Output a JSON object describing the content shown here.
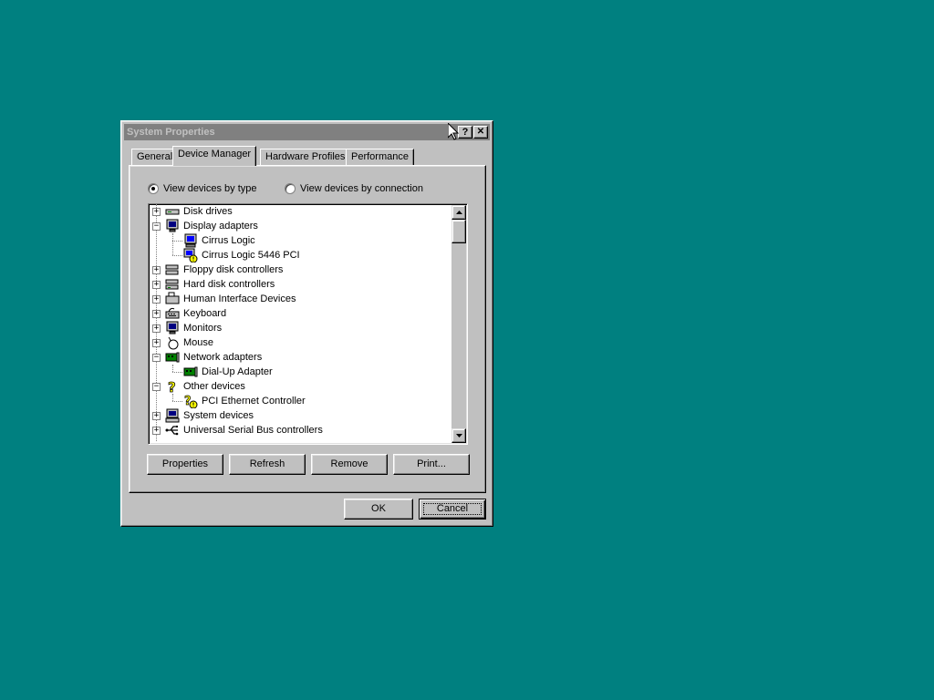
{
  "window": {
    "title": "System Properties",
    "help_glyph": "?",
    "close_glyph": "✕"
  },
  "tabs": [
    {
      "label": "General",
      "active": false
    },
    {
      "label": "Device Manager",
      "active": true
    },
    {
      "label": "Hardware Profiles",
      "active": false
    },
    {
      "label": "Performance",
      "active": false
    }
  ],
  "view_options": {
    "by_type": {
      "label": "View devices by type",
      "selected": true
    },
    "by_connection": {
      "label": "View devices by connection",
      "selected": false
    }
  },
  "tree": [
    {
      "label": "Disk drives",
      "level": 0,
      "expander": "+",
      "icon": "disk-drive-icon"
    },
    {
      "label": "Display adapters",
      "level": 0,
      "expander": "−",
      "icon": "monitor-icon"
    },
    {
      "label": "Cirrus Logic",
      "level": 1,
      "icon": "display-adapter-icon"
    },
    {
      "label": "Cirrus Logic 5446 PCI",
      "level": 1,
      "icon": "display-adapter-warning-icon"
    },
    {
      "label": "Floppy disk controllers",
      "level": 0,
      "expander": "+",
      "icon": "floppy-controller-icon"
    },
    {
      "label": "Hard disk controllers",
      "level": 0,
      "expander": "+",
      "icon": "hard-disk-controller-icon"
    },
    {
      "label": "Human Interface Devices",
      "level": 0,
      "expander": "+",
      "icon": "hid-icon"
    },
    {
      "label": "Keyboard",
      "level": 0,
      "expander": "+",
      "icon": "keyboard-icon"
    },
    {
      "label": "Monitors",
      "level": 0,
      "expander": "+",
      "icon": "monitor-icon"
    },
    {
      "label": "Mouse",
      "level": 0,
      "expander": "+",
      "icon": "mouse-icon"
    },
    {
      "label": "Network adapters",
      "level": 0,
      "expander": "−",
      "icon": "network-adapter-icon"
    },
    {
      "label": "Dial-Up Adapter",
      "level": 1,
      "icon": "network-adapter-icon"
    },
    {
      "label": "Other devices",
      "level": 0,
      "expander": "−",
      "icon": "question-mark-icon"
    },
    {
      "label": "PCI Ethernet Controller",
      "level": 1,
      "icon": "unknown-device-warning-icon"
    },
    {
      "label": "System devices",
      "level": 0,
      "expander": "+",
      "icon": "system-devices-icon"
    },
    {
      "label": "Universal Serial Bus controllers",
      "level": 0,
      "expander": "+",
      "icon": "usb-icon"
    }
  ],
  "buttons": {
    "properties": "Properties",
    "refresh": "Refresh",
    "remove": "Remove",
    "print": "Print...",
    "ok": "OK",
    "cancel": "Cancel"
  }
}
